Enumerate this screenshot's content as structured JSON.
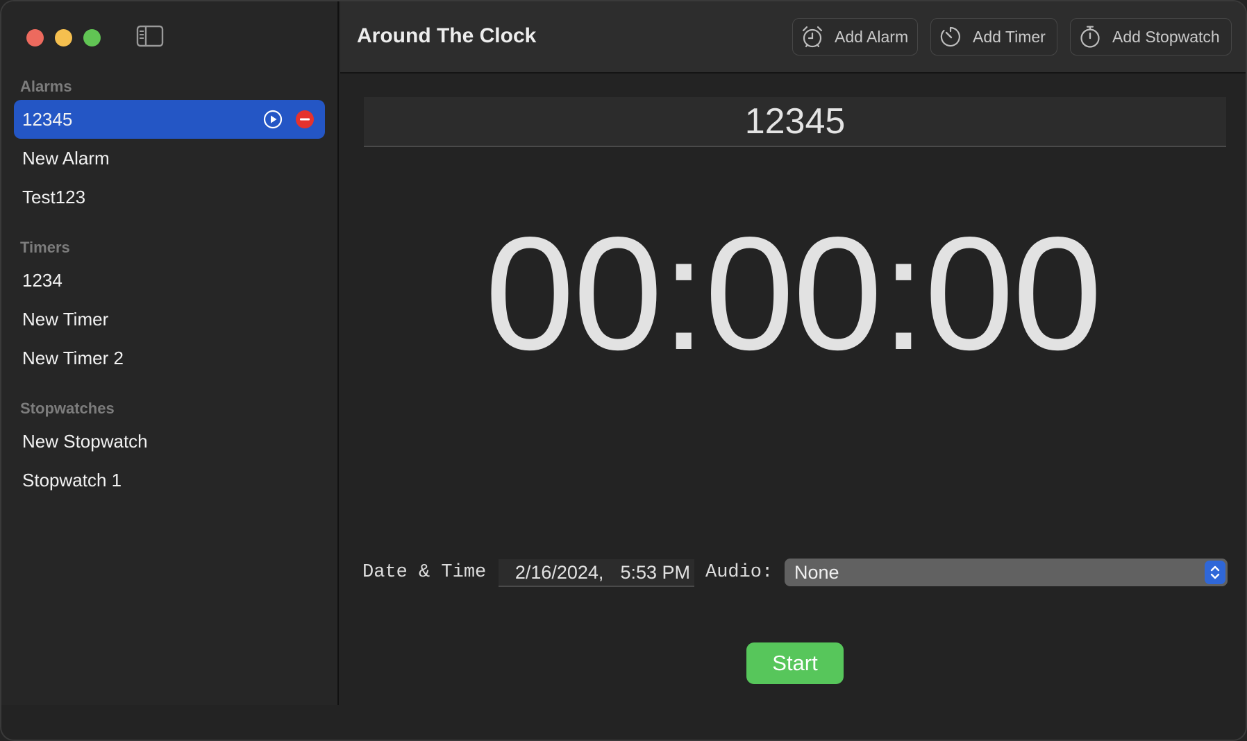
{
  "window": {
    "title": "Around The Clock"
  },
  "toolbar": {
    "add_alarm_label": "Add Alarm",
    "add_timer_label": "Add Timer",
    "add_stopwatch_label": "Add Stopwatch",
    "icons": [
      "alarm-clock-icon",
      "timer-icon",
      "stopwatch-icon"
    ]
  },
  "sidebar": {
    "alarms_header": "Alarms",
    "alarms": [
      {
        "label": "12345",
        "selected": true
      },
      {
        "label": "New Alarm"
      },
      {
        "label": "Test123"
      }
    ],
    "timers_header": "Timers",
    "timers": [
      {
        "label": "1234"
      },
      {
        "label": "New Timer"
      },
      {
        "label": "New Timer 2"
      }
    ],
    "stopwatches_header": "Stopwatches",
    "stopwatches": [
      {
        "label": "New Stopwatch"
      },
      {
        "label": "Stopwatch 1"
      }
    ]
  },
  "main": {
    "name_value": "12345",
    "time_display": "00:00:00",
    "date_time_label": "Date & Time",
    "date_value": "2/16/2024,",
    "time_value": "5:53 PM",
    "audio_label": "Audio:",
    "audio_selected": "None",
    "start_label": "Start"
  },
  "colors": {
    "selection": "#2456c5",
    "start_button": "#57c65b",
    "delete": "#e5322d",
    "close": "#ed6a5e",
    "minimize": "#f5bf4f",
    "maximize": "#61c554"
  }
}
